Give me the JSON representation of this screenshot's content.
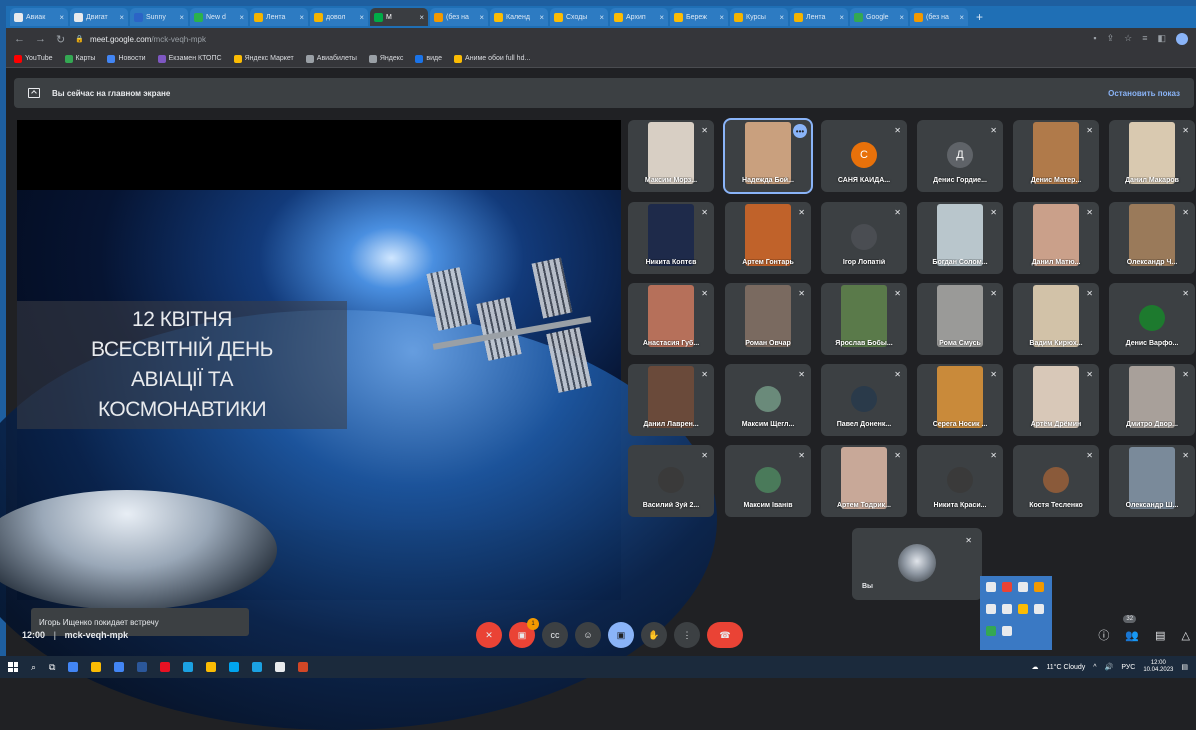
{
  "browser": {
    "tabs": [
      {
        "title": "Авиак",
        "color": "#e8eaed",
        "active": false
      },
      {
        "title": "Двигат",
        "color": "#e8eaed",
        "active": false
      },
      {
        "title": "Sunny",
        "color": "#2b64c6",
        "active": false
      },
      {
        "title": "New d",
        "color": "#2bb24c",
        "active": false
      },
      {
        "title": "Лента",
        "color": "#f4b400",
        "active": false
      },
      {
        "title": "довол",
        "color": "#f4b400",
        "active": false
      },
      {
        "title": "M",
        "color": "#00ac47",
        "active": true
      },
      {
        "title": "(без на",
        "color": "#f29900",
        "active": false
      },
      {
        "title": "Календ",
        "color": "#fbbc04",
        "active": false
      },
      {
        "title": "Сходы",
        "color": "#fbbc04",
        "active": false
      },
      {
        "title": "Архип",
        "color": "#fbbc04",
        "active": false
      },
      {
        "title": "Береж",
        "color": "#fbbc04",
        "active": false
      },
      {
        "title": "Курсы",
        "color": "#f4b400",
        "active": false
      },
      {
        "title": "Лента",
        "color": "#f4b400",
        "active": false
      },
      {
        "title": "Google",
        "color": "#34a853",
        "active": false
      },
      {
        "title": "(без на",
        "color": "#f29900",
        "active": false
      }
    ],
    "new_tab": "+",
    "url_host": "meet.google.com",
    "url_path": "/mck-veqh-mpk",
    "bookmarks": [
      {
        "label": "YouTube",
        "color": "#ff0000"
      },
      {
        "label": "Карты",
        "color": "#34a853"
      },
      {
        "label": "Новости",
        "color": "#4285f4"
      },
      {
        "label": "Екзамен КТОПС",
        "color": "#7e57c2"
      },
      {
        "label": "Яндекс Маркет",
        "color": "#fbbc04"
      },
      {
        "label": "Авиабилеты",
        "color": "#9aa0a6"
      },
      {
        "label": "Яндекс",
        "color": "#9aa0a6"
      },
      {
        "label": "виде",
        "color": "#1a73e8"
      },
      {
        "label": "Аниме обои full hd...",
        "color": "#fbbc04"
      }
    ]
  },
  "meet": {
    "banner_text": "Вы сейчас на главном экране",
    "stop_label": "Остановить показ",
    "slide": {
      "line1": "12 КВІТНЯ",
      "line2": "ВСЕСВІТНІЙ ДЕНЬ",
      "line3": "АВІАЦІЇ ТА",
      "line4": "КОСМОНАВТИКИ"
    },
    "toast": "Игорь Ищенко покидает встречу",
    "participants": [
      {
        "name": "Максим Морз...",
        "kind": "face",
        "color": "#d8cfc4"
      },
      {
        "name": "Надежда Бой...",
        "kind": "face",
        "color": "#c9a07e",
        "highlight": true
      },
      {
        "name": "САНЯ КАЙДА...",
        "kind": "letter",
        "letter": "С",
        "color": "#e8710a"
      },
      {
        "name": "Денис Гордие...",
        "kind": "letter",
        "letter": "Д",
        "color": "#5f6368"
      },
      {
        "name": "Денис Матер...",
        "kind": "face",
        "color": "#b07a4a"
      },
      {
        "name": "Данил Макаров",
        "kind": "face",
        "color": "#d9c9b0"
      },
      {
        "name": "Никита Коптєв",
        "kind": "face",
        "color": "#1e2a4a"
      },
      {
        "name": "Артем Гонтарь",
        "kind": "face",
        "color": "#c0622a"
      },
      {
        "name": "Ігор Лопатій",
        "kind": "round",
        "color": "#4a4d52"
      },
      {
        "name": "Богдан Солом...",
        "kind": "face",
        "color": "#b9c6cc"
      },
      {
        "name": "Данил Матю...",
        "kind": "face",
        "color": "#caa08a"
      },
      {
        "name": "Олександр Ч...",
        "kind": "face",
        "color": "#9a7a5a"
      },
      {
        "name": "Анастасия Губ...",
        "kind": "face",
        "color": "#b6705a"
      },
      {
        "name": "Роман Овчар",
        "kind": "face",
        "color": "#7a6a60"
      },
      {
        "name": "Ярослав Бобы...",
        "kind": "face",
        "color": "#5a7a4a"
      },
      {
        "name": "Рома Смусь",
        "kind": "face",
        "color": "#9a9a98"
      },
      {
        "name": "Вадим Кирюх...",
        "kind": "face",
        "color": "#d2c2a8"
      },
      {
        "name": "Денис Варфо...",
        "kind": "round",
        "color": "#1d7a2e"
      },
      {
        "name": "Данил Лаврен...",
        "kind": "face",
        "color": "#6a4a3a"
      },
      {
        "name": "Максим Щегл...",
        "kind": "round",
        "color": "#6a8a7a"
      },
      {
        "name": "Павел Доненк...",
        "kind": "round",
        "color": "#2a3a4a"
      },
      {
        "name": "Серега Носик ...",
        "kind": "face",
        "color": "#c98a3a"
      },
      {
        "name": "Артём Дрёмин",
        "kind": "face",
        "color": "#d8c8b8"
      },
      {
        "name": "Дмитро Двор...",
        "kind": "face",
        "color": "#a8a09a"
      },
      {
        "name": "Василий Зуй 2...",
        "kind": "round",
        "color": "#3a3a3a"
      },
      {
        "name": "Максим Іванів",
        "kind": "round",
        "color": "#4a7a5a"
      },
      {
        "name": "Артем Тодрик...",
        "kind": "face",
        "color": "#c8a898"
      },
      {
        "name": "Никита Краси...",
        "kind": "round",
        "color": "#3a3a3a"
      },
      {
        "name": "Костя Тесленко",
        "kind": "round",
        "color": "#8a5a3a"
      },
      {
        "name": "Олександр Ш...",
        "kind": "face",
        "color": "#7a8a9a"
      }
    ],
    "self": {
      "name": "Вы"
    },
    "time": "12:00",
    "meeting_code": "mck-veqh-mpk",
    "separator": "|",
    "chat_badge": "1",
    "participant_count": "32",
    "tray_colors": [
      "#e8eaed",
      "#ea4335",
      "#e8eaed",
      "#f29900",
      "#e8eaed",
      "#e8eaed",
      "#fbbc04",
      "#e8eaed",
      "#34a853",
      "#e8eaed"
    ]
  },
  "taskbar": {
    "weather": "11°C Cloudy",
    "lang": "РУС",
    "clock_time": "12:00",
    "clock_date": "10.04.2023",
    "app_colors": [
      "#4285f4",
      "#fbbc04",
      "#4285f4",
      "#2b579a",
      "#e81123",
      "#1ba1e2",
      "#fbbc04",
      "#00a4ef",
      "#1ba1e2",
      "#e8eaed",
      "#d24726"
    ]
  }
}
